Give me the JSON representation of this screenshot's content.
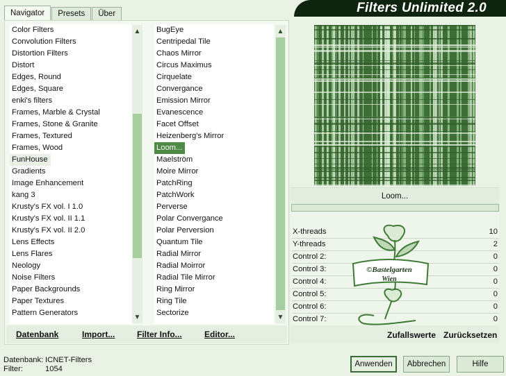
{
  "tabs": [
    "Navigator",
    "Presets",
    "Über"
  ],
  "title": "Filters Unlimited 2.0",
  "categories": [
    "Color Filters",
    "Convolution Filters",
    "Distortion Filters",
    "Distort",
    "Edges, Round",
    "Edges, Square",
    "enki's filters",
    "Frames, Marble & Crystal",
    "Frames, Stone & Granite",
    "Frames, Textured",
    "Frames, Wood",
    "FunHouse",
    "Gradients",
    "Image Enhancement",
    "kang 3",
    "Krusty's FX vol. I 1.0",
    "Krusty's FX vol. II 1.1",
    "Krusty's FX vol. II 2.0",
    "Lens Effects",
    "Lens Flares",
    "Neology",
    "Noise Filters",
    "Paper Backgrounds",
    "Paper Textures",
    "Pattern Generators"
  ],
  "filters": [
    "BugEye",
    "Centripedal Tile",
    "Chaos Mirror",
    "Circus Maximus",
    "Cirquelate",
    "Convergance",
    "Emission Mirror",
    "Evanescence",
    "Facet Offset",
    "Heizenberg's Mirror",
    "Loom...",
    "Maelström",
    "Moire Mirror",
    "PatchRing",
    "PatchWork",
    "Perverse",
    "Polar Convergance",
    "Polar Perversion",
    "Quantum Tile",
    "Radial Mirror",
    "Radial Moirror",
    "Radial Tile Mirror",
    "Ring Mirror",
    "Ring Tile",
    "Sectorize"
  ],
  "selected_category": "FunHouse",
  "selected_filter": "Loom...",
  "bottom_buttons": [
    "Datenbank",
    "Import...",
    "Filter Info...",
    "Editor..."
  ],
  "command_label": "Loom...",
  "params": [
    {
      "label": "X-threads",
      "value": "10"
    },
    {
      "label": "Y-threads",
      "value": "2"
    },
    {
      "label": "Control 2:",
      "value": "0"
    },
    {
      "label": "Control 3:",
      "value": "0"
    },
    {
      "label": "Control 4:",
      "value": "0"
    },
    {
      "label": "Control 5:",
      "value": "0"
    },
    {
      "label": "Control 6:",
      "value": "0"
    },
    {
      "label": "Control 7:",
      "value": "0"
    }
  ],
  "watermark": {
    "line1": "©Bastelgarten",
    "line2": "Wien"
  },
  "right_buttons": {
    "random": "Zufallswerte",
    "reset": "Zurücksetzen"
  },
  "footer": {
    "db_label": "Datenbank:",
    "db_value": "ICNET-Filters",
    "filter_label": "Filter:",
    "filter_value": "1054"
  },
  "actions": {
    "apply": "Anwenden",
    "cancel": "Abbrechen",
    "help": "Hilfe"
  },
  "colors": {
    "accent": "#4f8a47",
    "titlebar": "#0f240f",
    "background": "#e9f2e5"
  }
}
